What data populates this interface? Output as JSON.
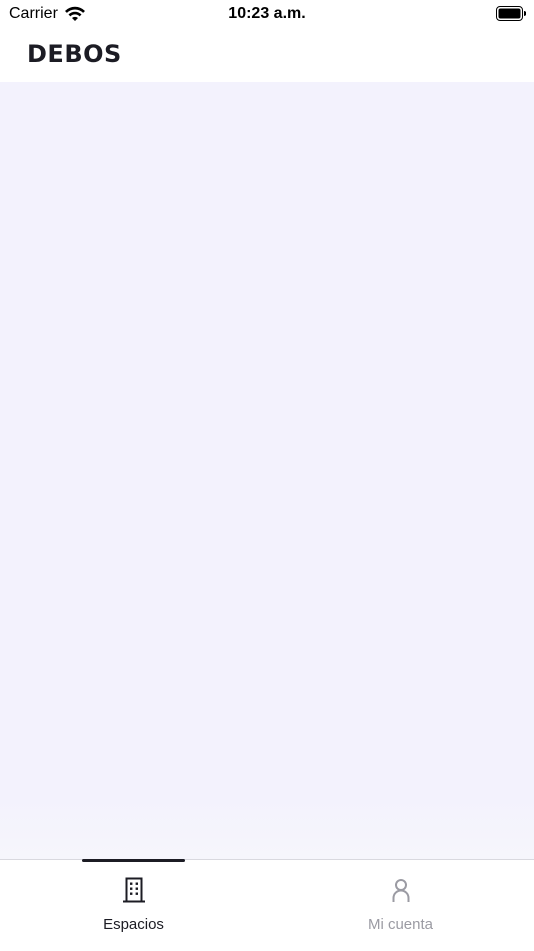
{
  "status_bar": {
    "carrier": "Carrier",
    "time": "10:23 a.m.",
    "icons": [
      "wifi-icon",
      "battery-icon"
    ]
  },
  "header": {
    "logo": "DEBOS"
  },
  "tab_bar": {
    "tabs": [
      {
        "label": "Espacios",
        "icon": "building-icon",
        "active": true
      },
      {
        "label": "Mi cuenta",
        "icon": "person-icon",
        "active": false
      }
    ]
  },
  "colors": {
    "content_background": "#f3f2fd",
    "active": "#1c1c24",
    "inactive": "#9b9ba3"
  }
}
